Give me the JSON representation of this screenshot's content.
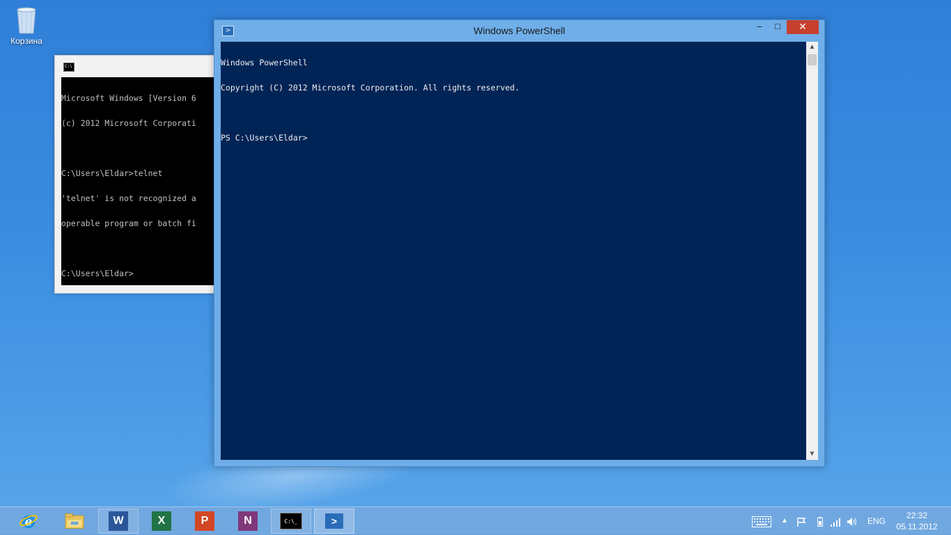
{
  "desktop": {
    "recycle_bin_label": "Корзина"
  },
  "cmd_window": {
    "lines": [
      "Microsoft Windows [Version 6",
      "(c) 2012 Microsoft Corporati",
      "",
      "C:\\Users\\Eldar>telnet",
      "'telnet' is not recognized a",
      "operable program or batch fi",
      "",
      "C:\\Users\\Eldar>"
    ]
  },
  "powershell_window": {
    "title": "Windows PowerShell",
    "minimize_glyph": "–",
    "maximize_glyph": "□",
    "close_glyph": "✕",
    "lines": [
      "Windows PowerShell",
      "Copyright (C) 2012 Microsoft Corporation. All rights reserved.",
      "",
      "PS C:\\Users\\Eldar>"
    ]
  },
  "taskbar": {
    "apps": [
      {
        "name": "Internet Explorer",
        "icon": "ie-icon",
        "glyph": "e"
      },
      {
        "name": "File Explorer",
        "icon": "folder-icon",
        "glyph": ""
      },
      {
        "name": "Word",
        "icon": "word-icon",
        "glyph": "W"
      },
      {
        "name": "Excel",
        "icon": "excel-icon",
        "glyph": "X"
      },
      {
        "name": "PowerPoint",
        "icon": "powerpoint-icon",
        "glyph": "P"
      },
      {
        "name": "OneNote",
        "icon": "onenote-icon",
        "glyph": "N"
      },
      {
        "name": "Command Prompt",
        "icon": "cmd-icon",
        "glyph": "C:\\_"
      },
      {
        "name": "Windows PowerShell",
        "icon": "powershell-icon",
        "glyph": "≥"
      }
    ],
    "language": "ENG",
    "time": "22:32",
    "date": "05.11.2012"
  },
  "colors": {
    "ps_background": "#012456",
    "ps_text": "#eeedf0",
    "close_button": "#c7402f",
    "word": "#2b579a",
    "excel": "#217346",
    "powerpoint": "#d24726",
    "onenote": "#80397b"
  }
}
